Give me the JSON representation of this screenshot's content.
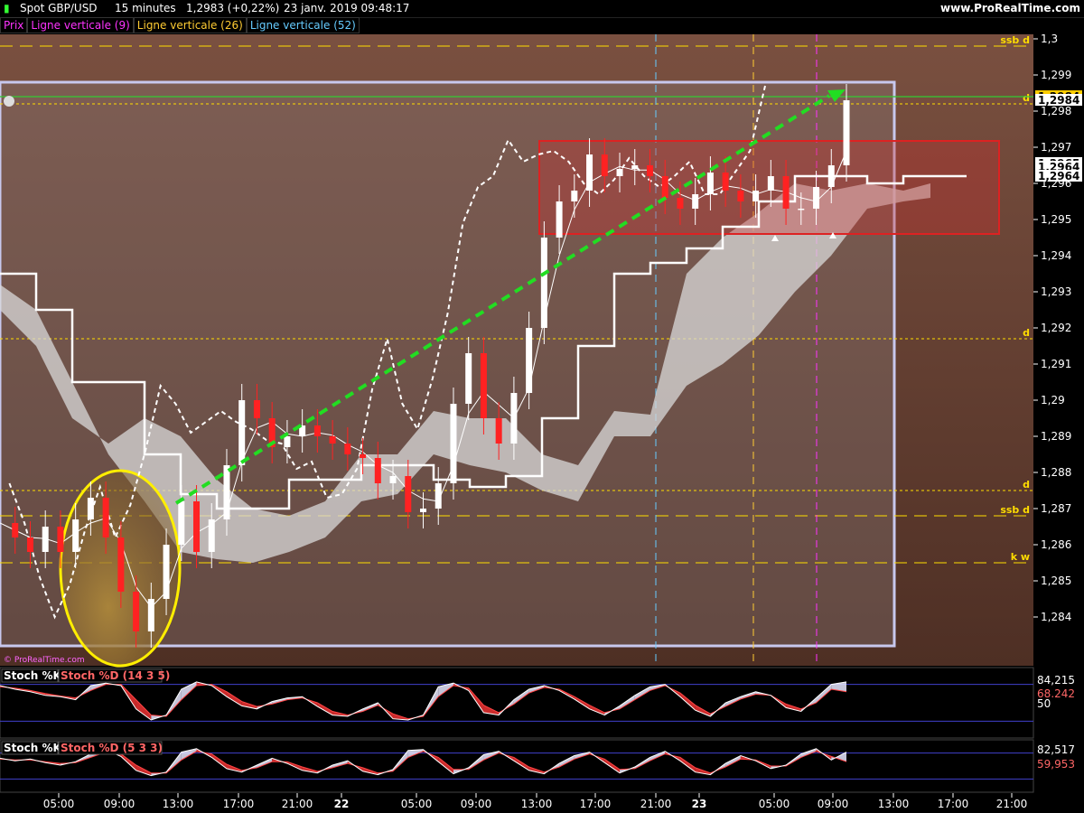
{
  "header": {
    "instrument": "Spot GBP/USD",
    "timeframe": "15 minutes",
    "price": "1,2983 (+0,22%)",
    "datetime": "23 janv. 2019 09:48:17",
    "site": "www.ProRealTime.com"
  },
  "legend": [
    {
      "label": "Prix",
      "color": "#ff33ff"
    },
    {
      "label": "Ligne verticale (9)",
      "color": "#ff33ff"
    },
    {
      "label": "Ligne verticale (26)",
      "color": "#ffcc33"
    },
    {
      "label": "Ligne verticale (52)",
      "color": "#66ccff"
    }
  ],
  "watermark": "© ProRealTime.com",
  "colors": {
    "background_upper": "#7a5040",
    "background_lower": "#4e2f24",
    "cloud": "#d9d9d9",
    "candle_up": "#ffffff",
    "candle_down": "#ff2222",
    "trend_arrow": "#22dd22",
    "box_red": "#dd2222",
    "ellipse": "#ffee00",
    "level_line": "#ffdd00"
  },
  "chart_data": [
    {
      "type": "line",
      "title": "Spot GBP/USD 15 minutes",
      "ylim": [
        1.283,
        1.3
      ],
      "y_ticks": [
        "1,3",
        "1,299",
        "1,298",
        "1,297",
        "1,296",
        "1,295",
        "1,294",
        "1,293",
        "1,292",
        "1,291",
        "1,29",
        "1,289",
        "1,288",
        "1,287",
        "1,286",
        "1,285",
        "1,284"
      ],
      "x_ticks": [
        "05:00",
        "09:00",
        "13:00",
        "17:00",
        "21:00",
        "22",
        "05:00",
        "09:00",
        "13:00",
        "17:00",
        "21:00",
        "23",
        "05:00",
        "09:00",
        "13:00",
        "17:00",
        "21:00"
      ],
      "price_tags": [
        {
          "label": "1,2984",
          "value": 1.2984,
          "highlight": true
        },
        {
          "label": "1,2984",
          "value": 1.2983
        },
        {
          "label": "1,2965",
          "value": 1.29655
        },
        {
          "label": "1,2964",
          "value": 1.29645
        },
        {
          "label": "1,2964",
          "value": 1.2962
        }
      ],
      "horizontal_levels": [
        {
          "label": "ssb d",
          "value": 1.2998,
          "style": "dashed"
        },
        {
          "label": "d",
          "value": 1.2982,
          "style": "dotted"
        },
        {
          "label": "d",
          "value": 1.2917,
          "style": "dotted"
        },
        {
          "label": "d",
          "value": 1.2875,
          "style": "dotted"
        },
        {
          "label": "ssb d",
          "value": 1.2868,
          "style": "dashed"
        },
        {
          "label": "k w",
          "value": 1.2855,
          "style": "dashed"
        }
      ],
      "series": [
        {
          "name": "Prix",
          "values": [
            1.2866,
            1.2862,
            1.2858,
            1.2865,
            1.2858,
            1.2867,
            1.2873,
            1.2862,
            1.2847,
            1.2836,
            1.2845,
            1.286,
            1.2872,
            1.2858,
            1.2867,
            1.2882,
            1.29,
            1.2895,
            1.2887,
            1.289,
            1.2893,
            1.289,
            1.2888,
            1.2885,
            1.2884,
            1.2877,
            1.2879,
            1.2869,
            1.287,
            1.2877,
            1.2899,
            1.2913,
            1.2895,
            1.2888,
            1.2902,
            1.292,
            1.2945,
            1.2955,
            1.2958,
            1.2968,
            1.2962,
            1.2964,
            1.2965,
            1.2962,
            1.2956,
            1.2953,
            1.2957,
            1.2963,
            1.2958,
            1.2955,
            1.2958,
            1.2962,
            1.2953,
            1.2953,
            1.2959,
            1.2965,
            1.2983
          ]
        }
      ],
      "annotations": [
        "trend arrow",
        "ellipse",
        "resistance box"
      ]
    },
    {
      "type": "line",
      "title": "Stoch %K",
      "subtitle": "Stoch %D (14 3 5)",
      "ylim": [
        0,
        100
      ],
      "y_ticks": [
        "84,215",
        "68,242",
        "50"
      ],
      "series": [
        {
          "name": "Stoch %K",
          "values": [
            78,
            72,
            68,
            62,
            60,
            55,
            78,
            82,
            78,
            40,
            22,
            30,
            72,
            84,
            78,
            60,
            45,
            40,
            52,
            58,
            60,
            44,
            30,
            28,
            40,
            50,
            24,
            22,
            30,
            76,
            82,
            70,
            34,
            30,
            55,
            72,
            78,
            70,
            56,
            40,
            30,
            45,
            62,
            76,
            80,
            60,
            38,
            28,
            50,
            60,
            68,
            62,
            42,
            36,
            58,
            80,
            84
          ]
        },
        {
          "name": "Stoch %D",
          "values": [
            76,
            74,
            70,
            65,
            61,
            58,
            70,
            80,
            80,
            55,
            30,
            28,
            55,
            78,
            80,
            68,
            52,
            44,
            48,
            55,
            58,
            50,
            36,
            30,
            36,
            46,
            32,
            24,
            28,
            60,
            78,
            74,
            46,
            34,
            48,
            66,
            75,
            72,
            60,
            46,
            34,
            40,
            55,
            70,
            78,
            66,
            46,
            32,
            44,
            56,
            64,
            62,
            48,
            40,
            50,
            72,
            68
          ]
        }
      ]
    },
    {
      "type": "line",
      "title": "Stoch %K",
      "subtitle": "Stoch %D (5 3 3)",
      "ylim": [
        0,
        100
      ],
      "y_ticks": [
        "82,517",
        "59,953"
      ],
      "series": [
        {
          "name": "Stoch %K",
          "values": [
            68,
            62,
            66,
            58,
            52,
            60,
            78,
            88,
            72,
            40,
            28,
            36,
            82,
            90,
            70,
            44,
            36,
            52,
            68,
            56,
            40,
            34,
            52,
            62,
            38,
            30,
            42,
            86,
            88,
            60,
            32,
            46,
            76,
            84,
            62,
            40,
            32,
            56,
            74,
            82,
            58,
            34,
            48,
            70,
            84,
            62,
            36,
            30,
            56,
            74,
            62,
            44,
            52,
            78,
            90,
            64,
            82
          ]
        },
        {
          "name": "Stoch %D",
          "values": [
            66,
            64,
            64,
            60,
            56,
            58,
            70,
            82,
            78,
            52,
            34,
            34,
            64,
            84,
            78,
            54,
            40,
            46,
            60,
            60,
            48,
            38,
            46,
            56,
            46,
            34,
            38,
            70,
            84,
            70,
            42,
            42,
            64,
            80,
            70,
            48,
            36,
            48,
            66,
            78,
            66,
            42,
            44,
            62,
            78,
            70,
            46,
            34,
            48,
            66,
            64,
            50,
            50,
            70,
            84,
            72,
            60
          ]
        }
      ]
    }
  ]
}
